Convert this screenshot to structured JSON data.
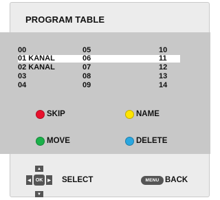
{
  "title": "PROGRAM TABLE",
  "channels": {
    "col0": [
      "00",
      "01 KANAL",
      "02 KANAL",
      "03",
      "04"
    ],
    "col1": [
      "05",
      "06",
      "07",
      "08",
      "09"
    ],
    "col2": [
      "10",
      "11",
      "12",
      "13",
      "14"
    ],
    "selected_row": 1
  },
  "legend": {
    "skip": "SKIP",
    "name": "NAME",
    "move": "MOVE",
    "delete": "DELETE"
  },
  "colors": {
    "red": "#e8112d",
    "yellow": "#ffe400",
    "green": "#1bb14a",
    "blue": "#2aa7e0",
    "panel": "#ececec",
    "grey_area": "#c8c8c8",
    "button": "#555555"
  },
  "footer": {
    "ok": "OK",
    "select": "SELECT",
    "menu": "MENU",
    "back": "BACK"
  },
  "icons": {
    "up": "▲",
    "down": "▼",
    "left": "◀",
    "right": "▶"
  }
}
